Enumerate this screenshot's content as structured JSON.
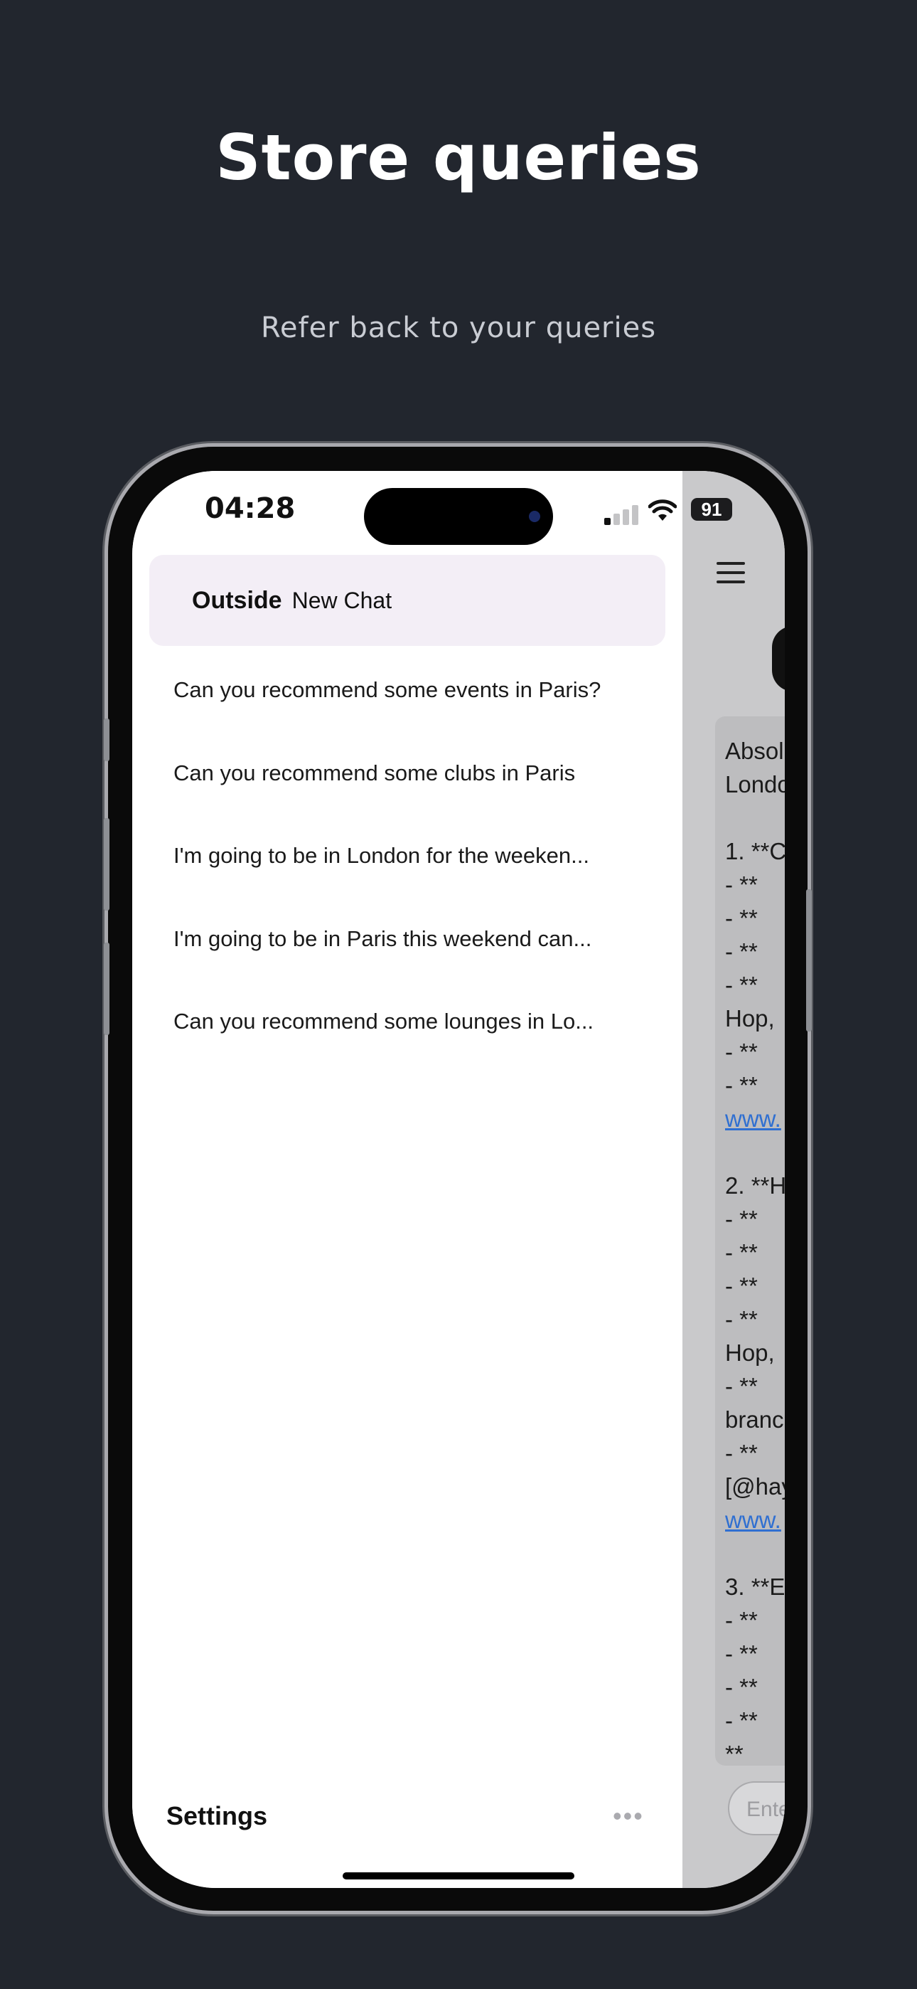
{
  "promo": {
    "title": "Store queries",
    "subtitle": "Refer back to your queries"
  },
  "status_bar": {
    "time": "04:28",
    "battery": "91"
  },
  "sidebar": {
    "brand": "Outside",
    "new_chat_label": "New Chat",
    "queries": [
      "Can you recommend some events in Paris?",
      "Can you recommend some clubs in Paris",
      "I'm going to be in London for the weeken...",
      "I'm going to be in Paris this weekend can...",
      "Can you recommend some lounges in Lo..."
    ],
    "settings_label": "Settings",
    "more_icon": "•••"
  },
  "chat_preview": {
    "lines": [
      "Absol",
      "Londo",
      "",
      "1. **C",
      "  - **",
      "  - **",
      "  - **",
      "  - **",
      "Hop, ",
      "  - **",
      "  - **",
      "www.",
      "",
      "2. **H",
      "  - **",
      "  - **",
      "  - **",
      "  - **",
      "Hop, ",
      "  - **",
      "branc",
      "  - **",
      "[@hay",
      "www.",
      "",
      "3. **E",
      "  - **",
      "  - **",
      "  - **",
      "  - **",
      "    **"
    ],
    "input_placeholder": "Ente"
  }
}
